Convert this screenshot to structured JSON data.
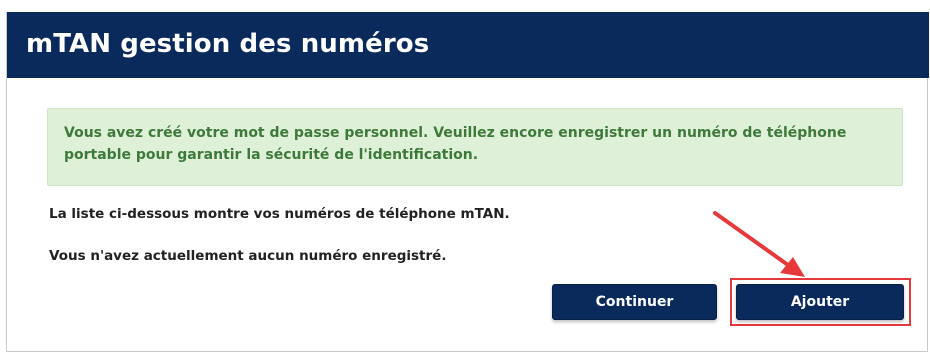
{
  "header": {
    "title": "mTAN gestion des numéros"
  },
  "alert": {
    "message": "Vous avez créé votre mot de passe personnel. Veuillez encore enregistrer un numéro de téléphone portable pour garantir la sécurité de l'identification."
  },
  "content": {
    "list_intro": "La liste ci-dessous montre vos numéros de téléphone mTAN.",
    "empty_notice": "Vous n'avez actuellement aucun numéro enregistré."
  },
  "actions": {
    "continue_label": "Continuer",
    "add_label": "Ajouter"
  },
  "annotation": {
    "highlight_color": "#e5393b",
    "highlight_target": "add-button"
  },
  "colors": {
    "header_bg": "#0b2a5c",
    "alert_bg": "#dff0d8",
    "alert_text": "#3d7a3a",
    "button_bg": "#0b2a5c"
  }
}
